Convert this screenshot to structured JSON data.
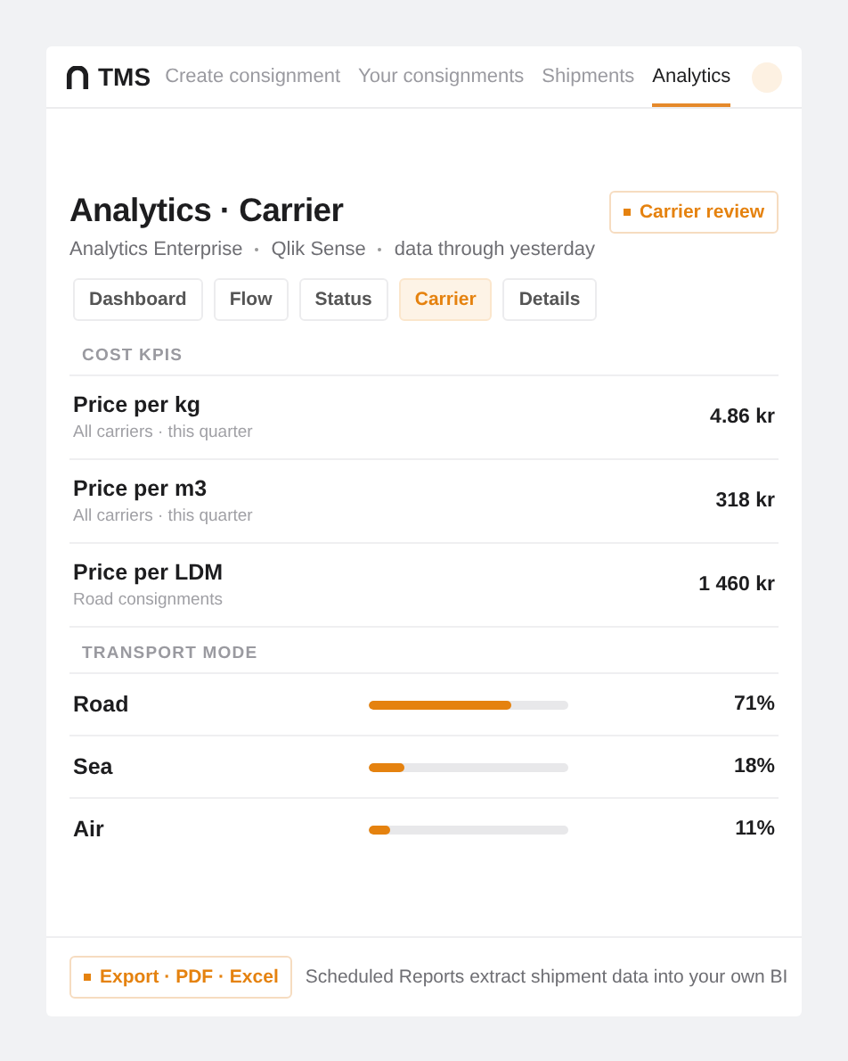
{
  "nav": {
    "brand": "TMS",
    "items": [
      {
        "label": "Create consignment",
        "selected": false
      },
      {
        "label": "Your consignments",
        "selected": false
      },
      {
        "label": "Shipments",
        "selected": false
      },
      {
        "label": "Analytics",
        "selected": true
      }
    ]
  },
  "header": {
    "title": "Analytics · Carrier",
    "subtitle": [
      "Analytics Enterprise",
      "Qlik Sense",
      "data through yesterday"
    ],
    "badge": "Carrier review"
  },
  "tabs": [
    {
      "label": "Dashboard",
      "selected": false
    },
    {
      "label": "Flow",
      "selected": false
    },
    {
      "label": "Status",
      "selected": false
    },
    {
      "label": "Carrier",
      "selected": true
    },
    {
      "label": "Details",
      "selected": false
    }
  ],
  "cost_kpis": {
    "heading": "COST KPIS",
    "rows": [
      {
        "name": "Price per kg",
        "note": "All carriers · this quarter",
        "value": "4.86 kr"
      },
      {
        "name": "Price per m3",
        "note": "All carriers · this quarter",
        "value": "318 kr"
      },
      {
        "name": "Price per LDM",
        "note": "Road consignments",
        "value": "1 460 kr"
      }
    ]
  },
  "transport_mode": {
    "heading": "TRANSPORT MODE",
    "rows": [
      {
        "name": "Road",
        "level": 0.71,
        "reading": "71%"
      },
      {
        "name": "Sea",
        "level": 0.18,
        "reading": "18%"
      },
      {
        "name": "Air",
        "level": 0.11,
        "reading": "11%"
      }
    ]
  },
  "footer": {
    "button": "Export · PDF · Excel",
    "text": "Scheduled Reports extract shipment data into your own BI"
  }
}
